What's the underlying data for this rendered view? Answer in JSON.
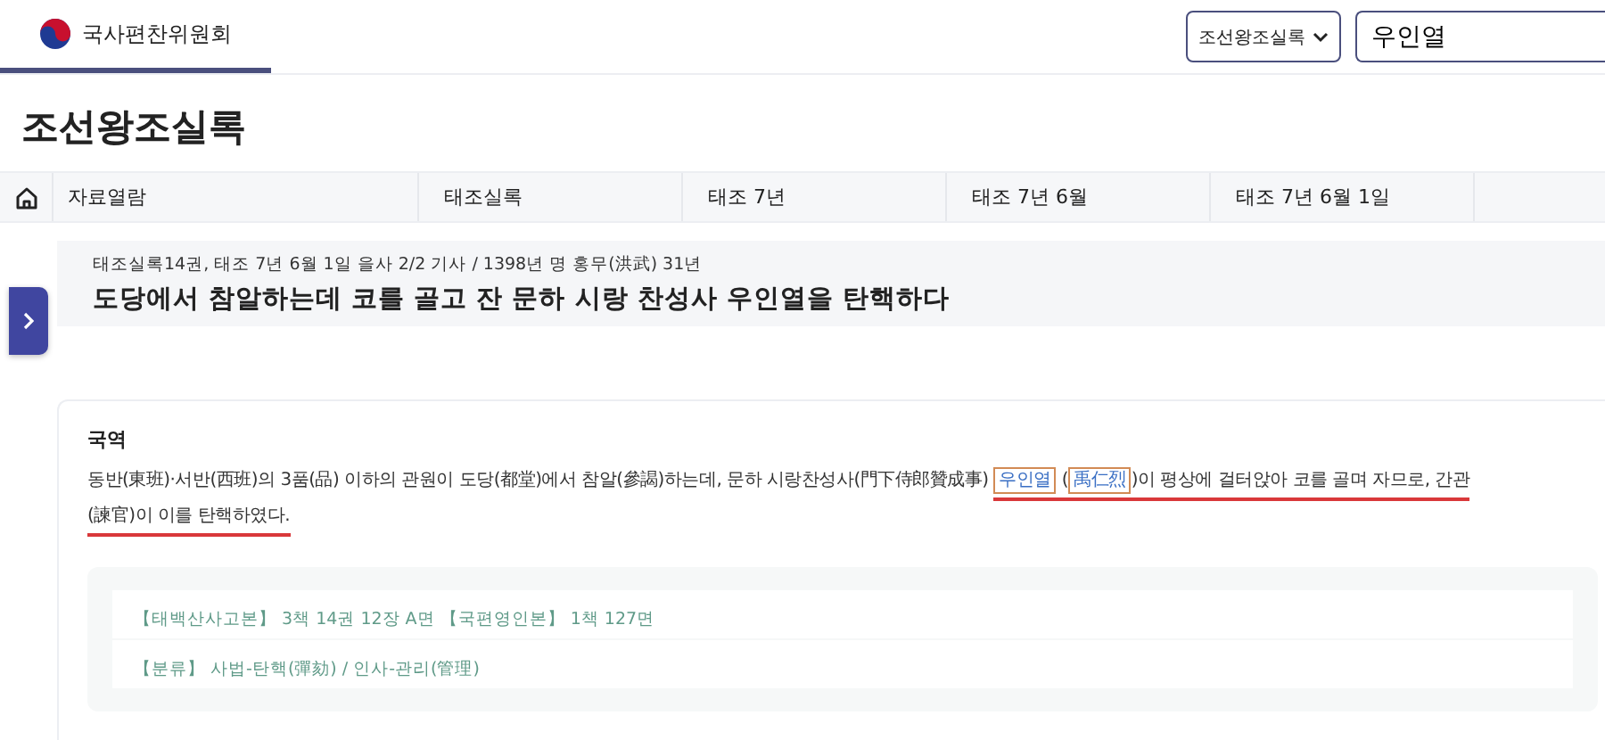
{
  "header": {
    "brand": "국사편찬위원회",
    "brand_selected": true,
    "scope_select": "조선왕조실록",
    "search": {
      "value": "우인열"
    }
  },
  "page_title": "조선왕조실록",
  "breadcrumb": [
    {
      "label": "자료열람"
    },
    {
      "label": "태조실록"
    },
    {
      "label": "태조 7년"
    },
    {
      "label": "태조 7년 6월"
    },
    {
      "label": "태조 7년 6월 1일"
    }
  ],
  "article": {
    "meta": "태조실록14권, 태조 7년 6월 1일 을사 2/2 기사 / 1398년 명 홍무(洪武) 31년",
    "title": "도당에서 참알하는데 코를 골고 잔 문하 시랑 찬성사 우인열을 탄핵하다"
  },
  "translation": {
    "heading": "국역",
    "lines": [
      [
        {
          "kind": "plain",
          "text": "동반(東班)·서반(西班)의 3품(品) 이하의 관원이 도당(都堂)에서 참알(參謁)하는데, 문하 시랑찬성사(門下侍郎贊成事) ",
          "underlined": false
        },
        {
          "kind": "term",
          "text": "우인열",
          "underlined": true
        },
        {
          "kind": "plain",
          "text": " (",
          "underlined": true
        },
        {
          "kind": "term",
          "text": "禹仁烈",
          "underlined": true
        },
        {
          "kind": "plain",
          "text": ")이 평상에 걸터앉아 코를 골며 자므로, 간관",
          "underlined": true
        }
      ],
      [
        {
          "kind": "plain",
          "text": "(諫官)이 이를 탄핵하였다.",
          "underlined": true
        }
      ]
    ]
  },
  "sources": [
    {
      "text": "【태백산사고본】 3책 14권 12장 A면 【국편영인본】 1책 127면"
    },
    {
      "text": "【분류】 사법-탄핵(彈劾) / 인사-관리(管理)"
    }
  ]
}
